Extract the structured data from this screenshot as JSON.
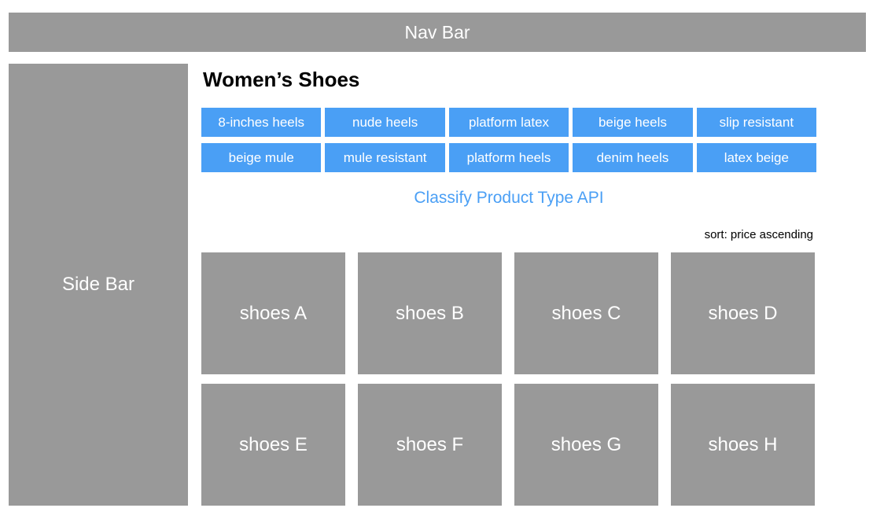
{
  "navbar": {
    "label": "Nav Bar"
  },
  "sidebar": {
    "label": "Side Bar"
  },
  "main": {
    "title": "Women’s Shoes",
    "tags_row1": [
      "8-inches heels",
      "nude heels",
      "platform latex",
      "beige heels",
      "slip resistant"
    ],
    "tags_row2": [
      "beige mule",
      "mule resistant",
      "platform heels",
      "denim heels",
      "latex beige"
    ],
    "api_link": "Classify Product Type API",
    "sort_label": "sort: price ascending",
    "products": [
      "shoes A",
      "shoes B",
      "shoes C",
      "shoes D",
      "shoes E",
      "shoes F",
      "shoes G",
      "shoes H"
    ]
  },
  "colors": {
    "placeholder_gray": "#999999",
    "tag_blue": "#4a9ff5",
    "link_blue": "#4a9ff5"
  }
}
